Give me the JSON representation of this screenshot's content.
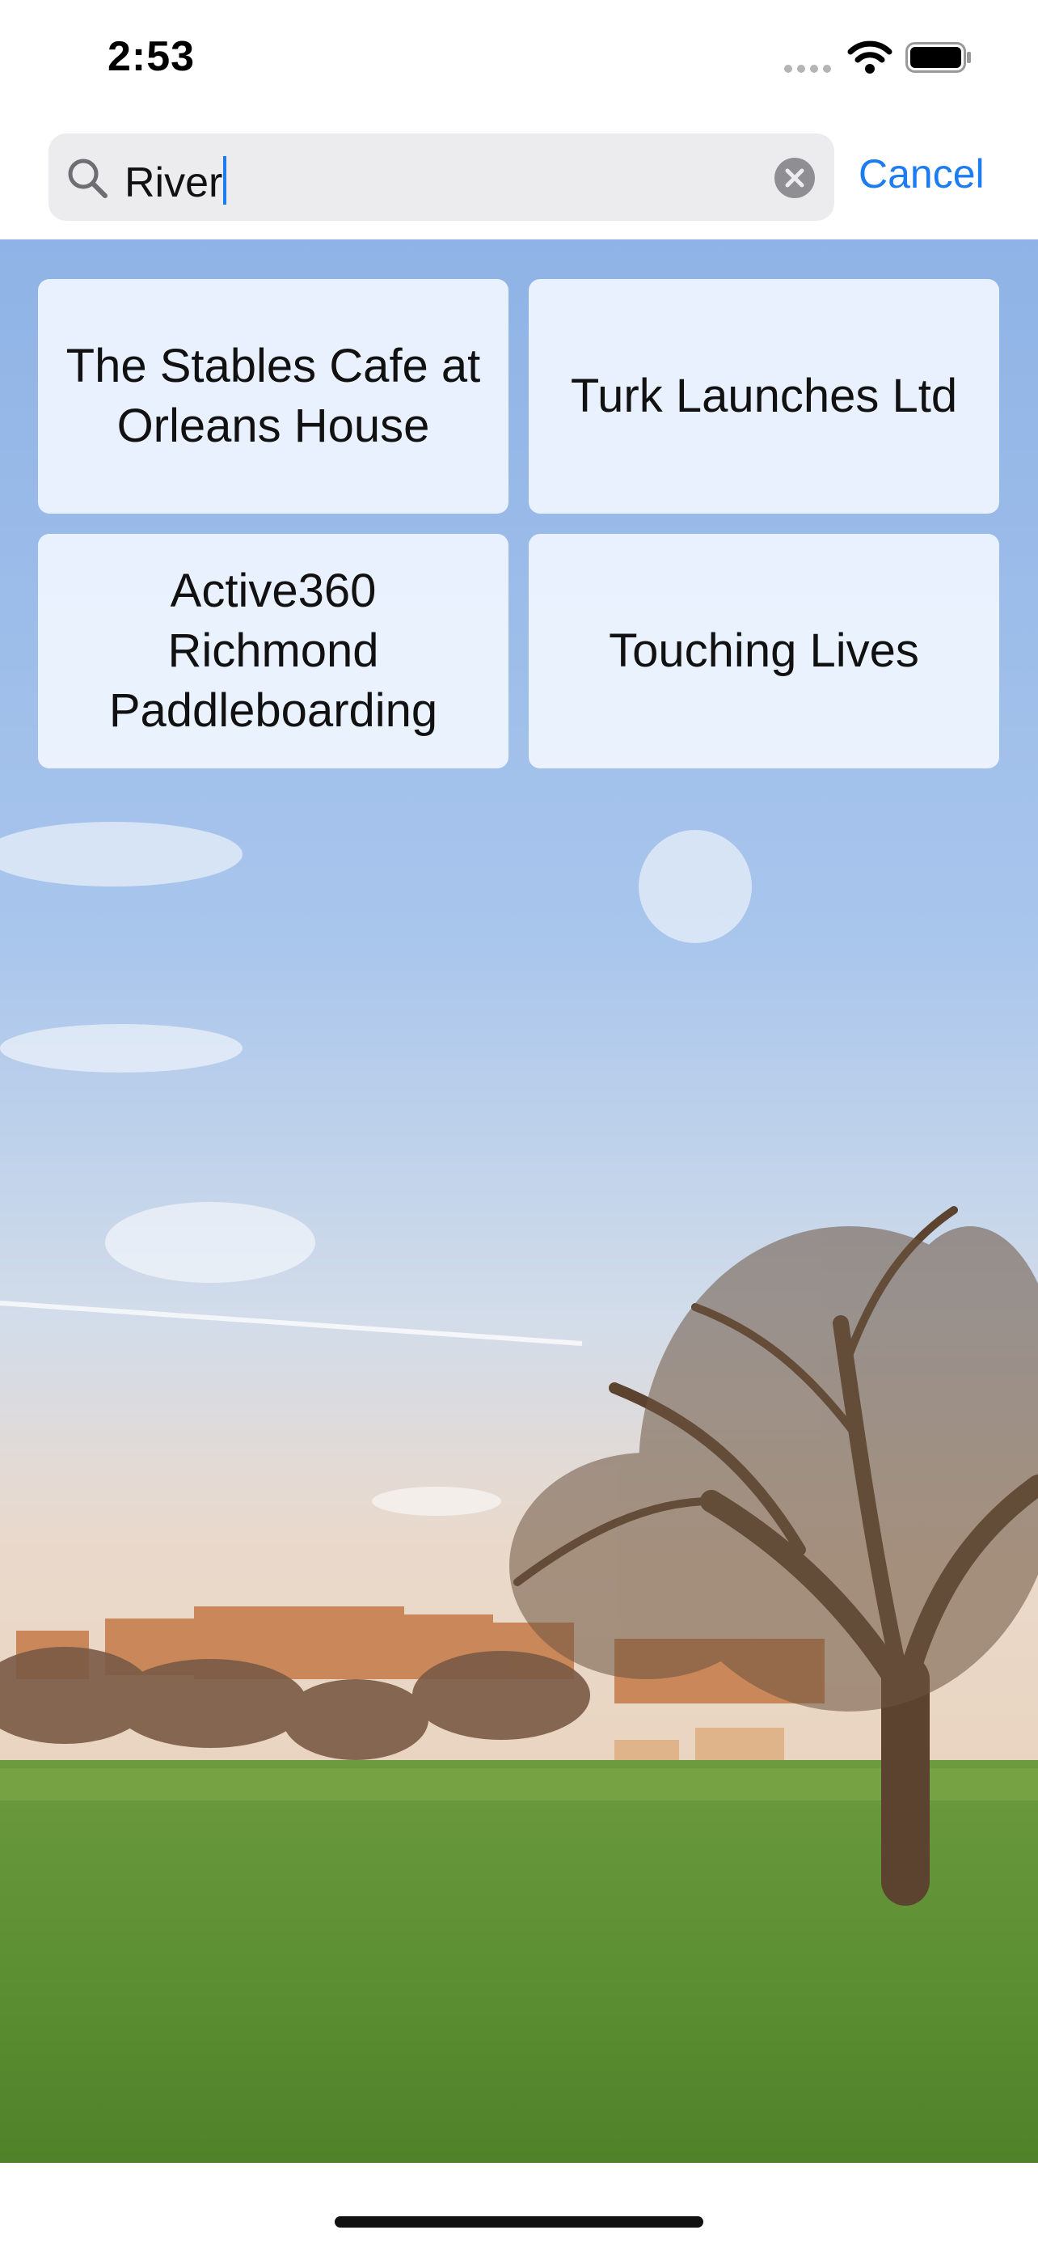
{
  "status_bar": {
    "time": "2:53",
    "icons": [
      "cellular-signal-icon",
      "wifi-icon",
      "battery-icon"
    ]
  },
  "search": {
    "value": "River",
    "cancel_label": "Cancel",
    "accent_color": "#1d7cf2"
  },
  "results": [
    {
      "label": "The Stables Cafe at Orleans House"
    },
    {
      "label": "Turk Launches Ltd"
    },
    {
      "label": "Active360 Richmond Paddleboarding"
    },
    {
      "label": "Touching Lives"
    }
  ],
  "background": {
    "description_icon": "landscape-photo",
    "colors": {
      "sky_top": "#8fb4e6",
      "sky_bottom": "#e6d8cc",
      "grass": "#5d8f33"
    }
  }
}
